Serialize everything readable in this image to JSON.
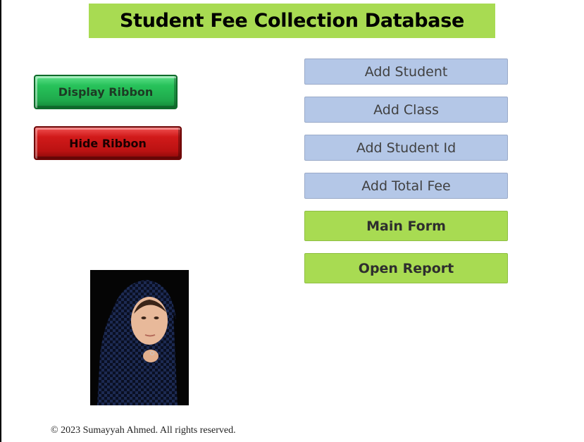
{
  "header": {
    "title": "Student Fee Collection Database"
  },
  "ribbon": {
    "display_label": "Display Ribbon",
    "hide_label": "Hide Ribbon"
  },
  "actions": [
    {
      "label": "Add Student"
    },
    {
      "label": "Add Class"
    },
    {
      "label": "Add Student Id"
    },
    {
      "label": "Add Total Fee"
    },
    {
      "label": "Main Form"
    },
    {
      "label": "Open Report"
    }
  ],
  "footer": {
    "copyright": "© 2023 Sumayyah Ahmed. All rights reserved."
  },
  "colors": {
    "title_bg": "#a8db52",
    "display_ribbon": "#1faa4c",
    "hide_ribbon": "#c41414",
    "action_blue": "#b4c7e7",
    "action_green": "#a8db52"
  }
}
